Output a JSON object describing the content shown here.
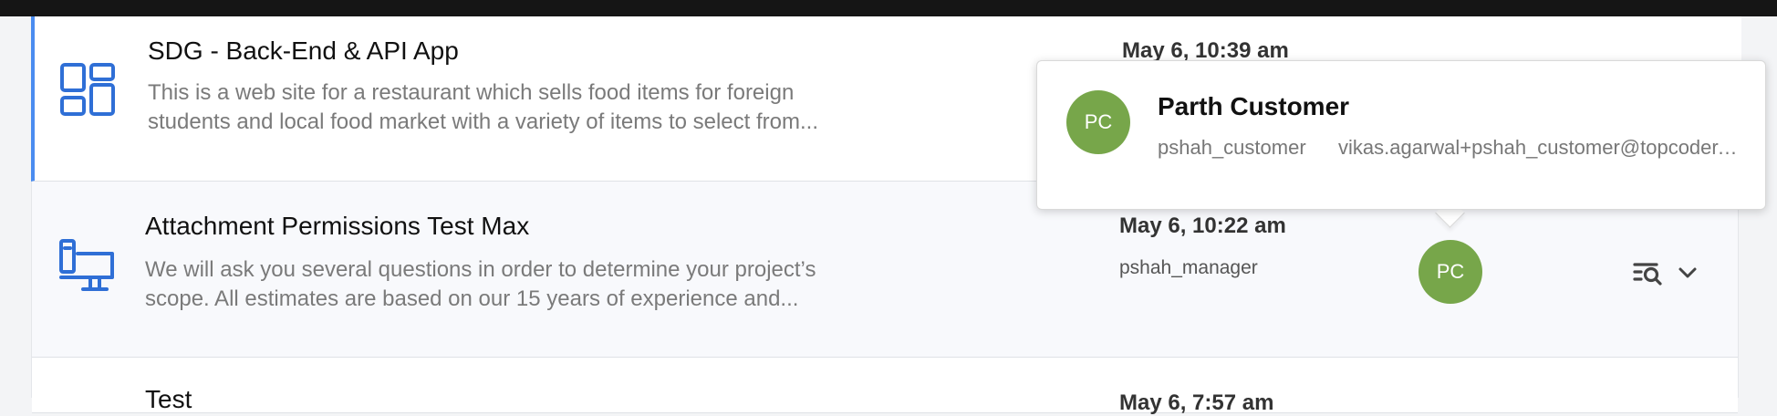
{
  "projects": [
    {
      "title": "SDG - Back-End & API App",
      "description_line1": "This is a web site for a restaurant which sells food items for foreign",
      "description_line2": "students and local food market with a variety of items to select from...",
      "date": "May 6, 10:39 am",
      "type_icon": "dashboard-layout-icon"
    },
    {
      "title": "Attachment Permissions Test Max",
      "description_line1": "We will ask you several questions in order to determine your project’s",
      "description_line2": "scope. All estimates are based on our 15 years of experience and...",
      "date": "May 6, 10:22 am",
      "username": "pshah_manager",
      "avatar_initials": "PC",
      "type_icon": "desktop-computer-icon"
    },
    {
      "title": "Test",
      "date": "May 6, 7:57 am"
    }
  ],
  "tooltip": {
    "avatar_initials": "PC",
    "name": "Parth Customer",
    "handle": "pshah_customer",
    "email": "vikas.agarwal+pshah_customer@topcoder.com"
  },
  "colors": {
    "accent": "#4a8cf0",
    "icon_blue": "#2f6fd6",
    "avatar_green": "#77a64a"
  }
}
